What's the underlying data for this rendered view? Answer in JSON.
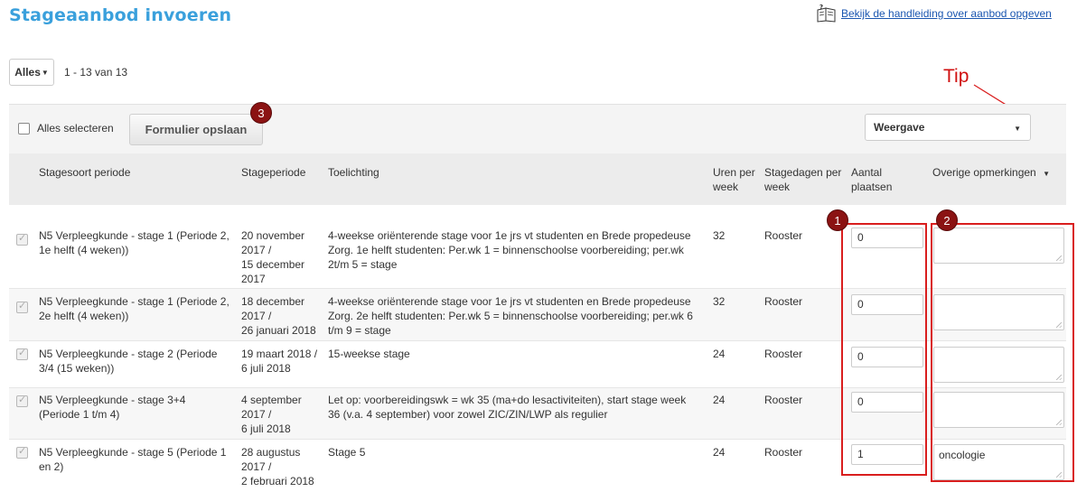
{
  "page": {
    "title": "Stageaanbod invoeren",
    "help_link": "Bekijk de handleiding over aanbod opgeven",
    "help_icon": "book-help-icon"
  },
  "filter": {
    "scope": "Alles",
    "count": "1 - 13 van 13"
  },
  "toolbar": {
    "select_all": "Alles selecteren",
    "save": "Formulier opslaan",
    "view": "Weergave"
  },
  "annotations": {
    "tip": "Tip",
    "badge_1": "1",
    "badge_2": "2",
    "badge_3": "3",
    "color": "#d91e1e",
    "badge_color": "#8b1313"
  },
  "table": {
    "headers": {
      "type": "Stagesoort periode",
      "period": "Stageperiode",
      "note": "Toelichting",
      "hours_1": "Uren per",
      "hours_2": "week",
      "days_1": "Stagedagen per",
      "days_2": "week",
      "places_1": "Aantal",
      "places_2": "plaatsen",
      "remarks": "Overige opmerkingen"
    },
    "rows": [
      {
        "type": [
          "N5 Verpleegkunde - stage 1 (Periode 2,",
          "1e helft (4 weken))"
        ],
        "period": [
          "20 november",
          "2017 /",
          "15 december",
          "2017"
        ],
        "note": [
          "4-weekse oriënterende stage voor 1e jrs vt studenten en Brede propedeuse",
          "Zorg. 1e helft studenten: Per.wk 1 = binnenschoolse voorbereiding; per.wk",
          "2t/m 5 = stage"
        ],
        "hours": "32",
        "days": "Rooster",
        "places": "0",
        "remarks": ""
      },
      {
        "type": [
          "N5 Verpleegkunde - stage 1 (Periode 2,",
          "2e helft (4 weken))"
        ],
        "period": [
          "18 december",
          "2017 /",
          "26 januari 2018"
        ],
        "note": [
          "4-weekse oriënterende stage voor 1e jrs vt studenten en Brede propedeuse",
          "Zorg. 2e helft studenten: Per.wk 5 = binnenschoolse voorbereiding; per.wk 6",
          "t/m 9 = stage"
        ],
        "hours": "32",
        "days": "Rooster",
        "places": "0",
        "remarks": ""
      },
      {
        "type": [
          "N5 Verpleegkunde - stage 2 (Periode",
          "3/4 (15 weken))"
        ],
        "period": [
          "19 maart 2018 /",
          "6 juli 2018"
        ],
        "note": [
          "15-weekse stage"
        ],
        "hours": "24",
        "days": "Rooster",
        "places": "0",
        "remarks": ""
      },
      {
        "type": [
          "N5 Verpleegkunde - stage 3+4",
          "(Periode 1 t/m 4)"
        ],
        "period": [
          "4 september",
          "2017 /",
          "6 juli 2018"
        ],
        "note": [
          "Let op: voorbereidingswk = wk 35 (ma+do lesactiviteiten), start stage week",
          "36 (v.a. 4 september) voor zowel ZIC/ZIN/LWP als regulier"
        ],
        "hours": "24",
        "days": "Rooster",
        "places": "0",
        "remarks": ""
      },
      {
        "type": [
          "N5 Verpleegkunde - stage 5 (Periode 1",
          "en 2)"
        ],
        "period": [
          "28 augustus",
          "2017 /",
          "2 februari 2018"
        ],
        "note": [
          "Stage 5"
        ],
        "hours": "24",
        "days": "Rooster",
        "places": "1",
        "remarks": "oncologie"
      }
    ]
  }
}
